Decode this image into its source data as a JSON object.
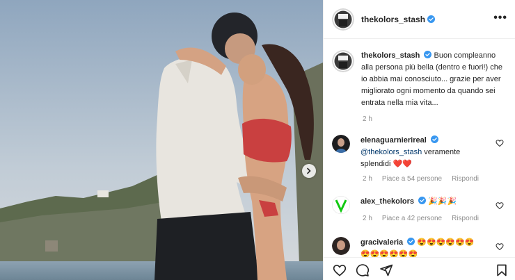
{
  "post": {
    "username": "thekolors_stash",
    "more_label": "•••"
  },
  "caption": {
    "username": "thekolors_stash",
    "text": "Buon compleanno alla persona più bella (dentro e fuori!) che io abbia mai conosciuto... grazie per aver migliorato ogni momento da quando sei entrata nella mia vita...",
    "time": "2 h"
  },
  "comments": [
    {
      "username": "elenaguarnierireal",
      "mention": "@thekolors_stash",
      "text": " veramente splendidi ",
      "emoji": "❤️❤️",
      "time": "2 h",
      "likes": "Piace a 54 persone",
      "reply": "Rispondi"
    },
    {
      "username": "alex_thekolors",
      "text": " ",
      "emoji": "🎉🎉🎉",
      "time": "2 h",
      "likes": "Piace a 42 persone",
      "reply": "Rispondi"
    },
    {
      "username": "gracivaleria",
      "text": " ",
      "emoji": "😍😍😍😍😍😍😍😍😍😍😍😍",
      "time": "",
      "likes": "",
      "reply": ""
    }
  ],
  "colors": {
    "verified": "#3897f0",
    "text": "#262626",
    "muted": "#8e8e8e",
    "mention": "#00376b"
  },
  "icons": [
    "heart-icon",
    "comment-icon",
    "share-icon",
    "bookmark-icon",
    "verified-badge-icon",
    "chevron-right-icon"
  ]
}
